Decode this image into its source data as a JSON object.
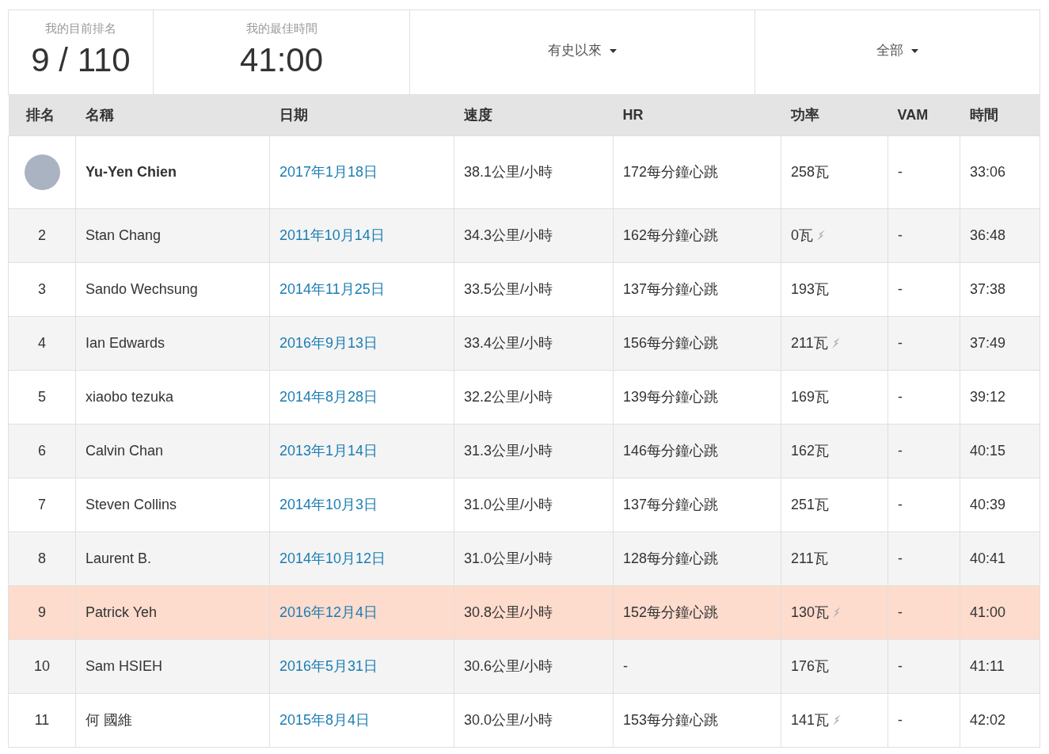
{
  "stats": [
    {
      "label": "我的目前排名",
      "value": "9 / 110"
    },
    {
      "label": "我的最佳時間",
      "value": "41:00"
    }
  ],
  "filters": [
    {
      "label": "有史以來"
    },
    {
      "label": "全部"
    }
  ],
  "table": {
    "columns": [
      "排名",
      "名稱",
      "日期",
      "速度",
      "HR",
      "功率",
      "VAM",
      "時間"
    ],
    "rows": [
      {
        "kind": "avatar",
        "name": "Yu-Yen Chien",
        "date": "2017年1月18日",
        "speed": "38.1公里/小時",
        "hr": "172每分鐘心跳",
        "power": "258瓦",
        "estimated": false,
        "vam": "-",
        "time": "33:06",
        "selected": false
      },
      {
        "kind": "rank",
        "rank": "2",
        "name": "Stan Chang",
        "date": "2011年10月14日",
        "speed": "34.3公里/小時",
        "hr": "162每分鐘心跳",
        "power": "0瓦",
        "estimated": true,
        "vam": "-",
        "time": "36:48",
        "selected": false
      },
      {
        "kind": "rank",
        "rank": "3",
        "name": "Sando Wechsung",
        "date": "2014年11月25日",
        "speed": "33.5公里/小時",
        "hr": "137每分鐘心跳",
        "power": "193瓦",
        "estimated": false,
        "vam": "-",
        "time": "37:38",
        "selected": false
      },
      {
        "kind": "rank",
        "rank": "4",
        "name": "Ian Edwards",
        "date": "2016年9月13日",
        "speed": "33.4公里/小時",
        "hr": "156每分鐘心跳",
        "power": "211瓦",
        "estimated": true,
        "vam": "-",
        "time": "37:49",
        "selected": false
      },
      {
        "kind": "rank",
        "rank": "5",
        "name": "xiaobo tezuka",
        "date": "2014年8月28日",
        "speed": "32.2公里/小時",
        "hr": "139每分鐘心跳",
        "power": "169瓦",
        "estimated": false,
        "vam": "-",
        "time": "39:12",
        "selected": false
      },
      {
        "kind": "rank",
        "rank": "6",
        "name": "Calvin Chan",
        "date": "2013年1月14日",
        "speed": "31.3公里/小時",
        "hr": "146每分鐘心跳",
        "power": "162瓦",
        "estimated": false,
        "vam": "-",
        "time": "40:15",
        "selected": false
      },
      {
        "kind": "rank",
        "rank": "7",
        "name": "Steven Collins",
        "date": "2014年10月3日",
        "speed": "31.0公里/小時",
        "hr": "137每分鐘心跳",
        "power": "251瓦",
        "estimated": false,
        "vam": "-",
        "time": "40:39",
        "selected": false
      },
      {
        "kind": "rank",
        "rank": "8",
        "name": "Laurent B.",
        "date": "2014年10月12日",
        "speed": "31.0公里/小時",
        "hr": "128每分鐘心跳",
        "power": "211瓦",
        "estimated": false,
        "vam": "-",
        "time": "40:41",
        "selected": false
      },
      {
        "kind": "rank",
        "rank": "9",
        "name": "Patrick Yeh",
        "date": "2016年12月4日",
        "speed": "30.8公里/小時",
        "hr": "152每分鐘心跳",
        "power": "130瓦",
        "estimated": true,
        "vam": "-",
        "time": "41:00",
        "selected": true
      },
      {
        "kind": "rank",
        "rank": "10",
        "name": "Sam HSIEH",
        "date": "2016年5月31日",
        "speed": "30.6公里/小時",
        "hr": "-",
        "power": "176瓦",
        "estimated": false,
        "vam": "-",
        "time": "41:11",
        "selected": false
      },
      {
        "kind": "rank",
        "rank": "11",
        "name": "何 國維",
        "date": "2015年8月4日",
        "speed": "30.0公里/小時",
        "hr": "153每分鐘心跳",
        "power": "141瓦",
        "estimated": true,
        "vam": "-",
        "time": "42:02",
        "selected": false
      }
    ]
  }
}
